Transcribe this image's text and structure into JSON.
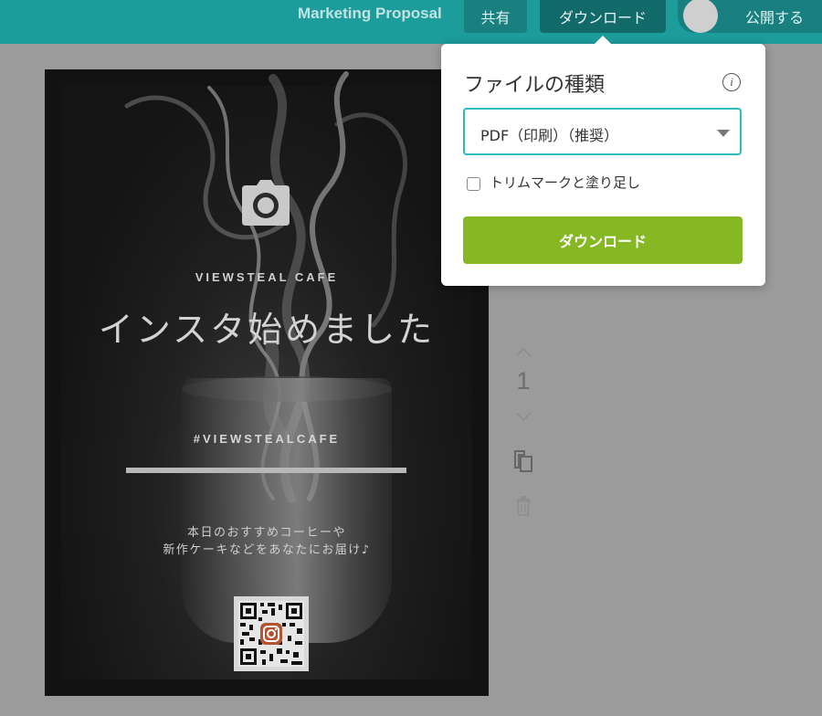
{
  "topbar": {
    "document_title": "Marketing Proposal",
    "share_label": "共有",
    "download_label": "ダウンロード",
    "publish_label": "公開する",
    "color": "#1d9c9c"
  },
  "poster": {
    "brand": "VIEWSTEAL CAFE",
    "headline": "インスタ始めました",
    "hashtag": "#VIEWSTEALCAFE",
    "body_line1": "本日のおすすめコーヒーや",
    "body_line2": "新作ケーキなどをあなたにお届け♪",
    "icons": [
      "camera-icon",
      "instagram-icon"
    ]
  },
  "page_tools": {
    "page_number": "1",
    "icons": [
      "chevron-up-icon",
      "chevron-down-icon",
      "copy-icon",
      "trash-icon"
    ]
  },
  "download_panel": {
    "title": "ファイルの種類",
    "info_icon": "i",
    "file_type_value": "PDF（印刷）（推奨）",
    "trim_marks_label": "トリムマークと塗り足し",
    "trim_marks_checked": false,
    "download_button": "ダウンロード",
    "button_color": "#86b824",
    "select_border_color": "#2bbcbc"
  }
}
